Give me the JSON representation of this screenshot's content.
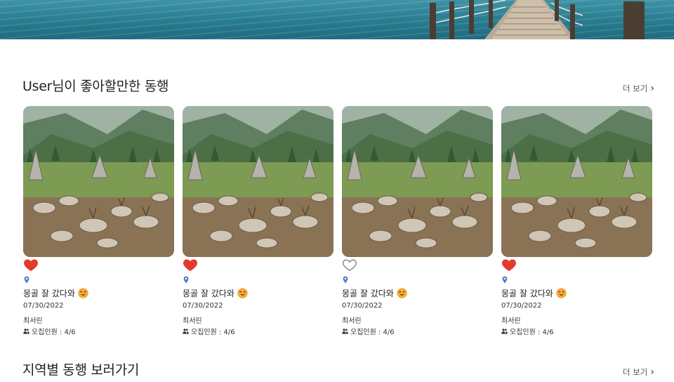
{
  "colors": {
    "heart_filled": "#e23b2e",
    "heart_outline": "#888888",
    "pin": "#4a7fc0",
    "text": "#222222"
  },
  "section1": {
    "title": "User님이 좋아할만한 동행",
    "more": "더 보기"
  },
  "section2": {
    "title": "지역별 동행 보러가기",
    "more": "더 보기"
  },
  "cards": [
    {
      "liked": true,
      "title": "몽골 잘 갔다와",
      "date": "07/30/2022",
      "author": "최서린",
      "recruit": "오집인원 : 4/6"
    },
    {
      "liked": true,
      "title": "몽골 잘 갔다와",
      "date": "07/30/2022",
      "author": "최서린",
      "recruit": "오집인원 : 4/6"
    },
    {
      "liked": false,
      "title": "몽골 잘 갔다와",
      "date": "07/30/2022",
      "author": "최서린",
      "recruit": "오집인원 : 4/6"
    },
    {
      "liked": true,
      "title": "몽골 잘 갔다와",
      "date": "07/30/2022",
      "author": "최서린",
      "recruit": "오집인원 : 4/6"
    }
  ]
}
